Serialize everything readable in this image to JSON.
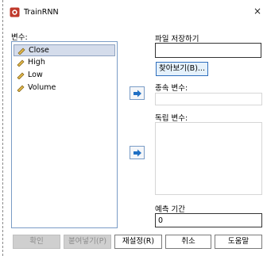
{
  "window": {
    "title": "TrainRNN",
    "close_glyph": "×"
  },
  "variables": {
    "label": "변수:",
    "items": [
      {
        "label": "Close",
        "selected": true
      },
      {
        "label": "High",
        "selected": false
      },
      {
        "label": "Low",
        "selected": false
      },
      {
        "label": "Volume",
        "selected": false
      }
    ]
  },
  "save_file": {
    "label": "파일 저장하기",
    "value": "",
    "browse_label": "찾아보기(B)..."
  },
  "dependent": {
    "label": "종속 변수:",
    "value": ""
  },
  "independent": {
    "label": "독립 변수:",
    "value": ""
  },
  "forecast": {
    "label": "예측 기간",
    "value": "0"
  },
  "buttons": {
    "ok": "확인",
    "paste": "붙여넣기(P)",
    "reset": "재설정(R)",
    "cancel": "취소",
    "help": "도움말"
  },
  "icons": {
    "app": "spss-app-icon",
    "variable": "ruler-scale-icon",
    "move": "right-arrow-icon"
  },
  "colors": {
    "list_border": "#7a9cc6",
    "selection": "#d4dceb",
    "arrow": "#1f6fc4"
  }
}
